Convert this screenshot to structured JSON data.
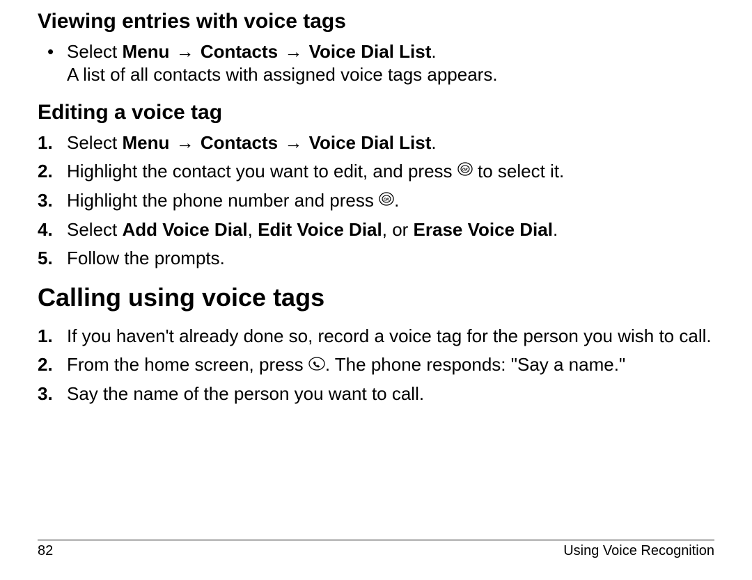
{
  "sections": {
    "viewing": {
      "title": "Viewing entries with voice tags",
      "bullet": {
        "line1_prefix": "Select ",
        "path_menu": "Menu",
        "path_contacts": "Contacts",
        "path_vdl": "Voice Dial List",
        "period": ".",
        "line2": "A list of all contacts with assigned voice tags appears."
      }
    },
    "editing": {
      "title": "Editing a voice tag",
      "steps": [
        {
          "num": "1.",
          "prefix": "Select ",
          "path_menu": "Menu",
          "path_contacts": "Contacts",
          "path_vdl": "Voice Dial List",
          "period": "."
        },
        {
          "num": "2.",
          "before": "Highlight the contact you want to edit, and press ",
          "icon": "ok-key-icon",
          "after": " to select it."
        },
        {
          "num": "3.",
          "before": "Highlight the phone number and press ",
          "icon": "ok-key-icon",
          "after": "."
        },
        {
          "num": "4.",
          "prefix": "Select ",
          "b1": "Add Voice Dial",
          "c1": ", ",
          "b2": "Edit Voice Dial",
          "c2": ", or ",
          "b3": "Erase Voice Dial",
          "period": "."
        },
        {
          "num": "5.",
          "text": "Follow the prompts."
        }
      ]
    },
    "calling": {
      "title": "Calling using voice tags",
      "steps": [
        {
          "num": "1.",
          "text": "If you haven't already done so, record a voice tag for the person you wish to call."
        },
        {
          "num": "2.",
          "before": "From the home screen, press ",
          "icon": "call-key-icon",
          "after": ". The phone responds: \"Say a name.\""
        },
        {
          "num": "3.",
          "text": "Say the name of the person you want to call."
        }
      ]
    }
  },
  "arrow": "→",
  "footer": {
    "page": "82",
    "section": "Using Voice Recognition"
  }
}
